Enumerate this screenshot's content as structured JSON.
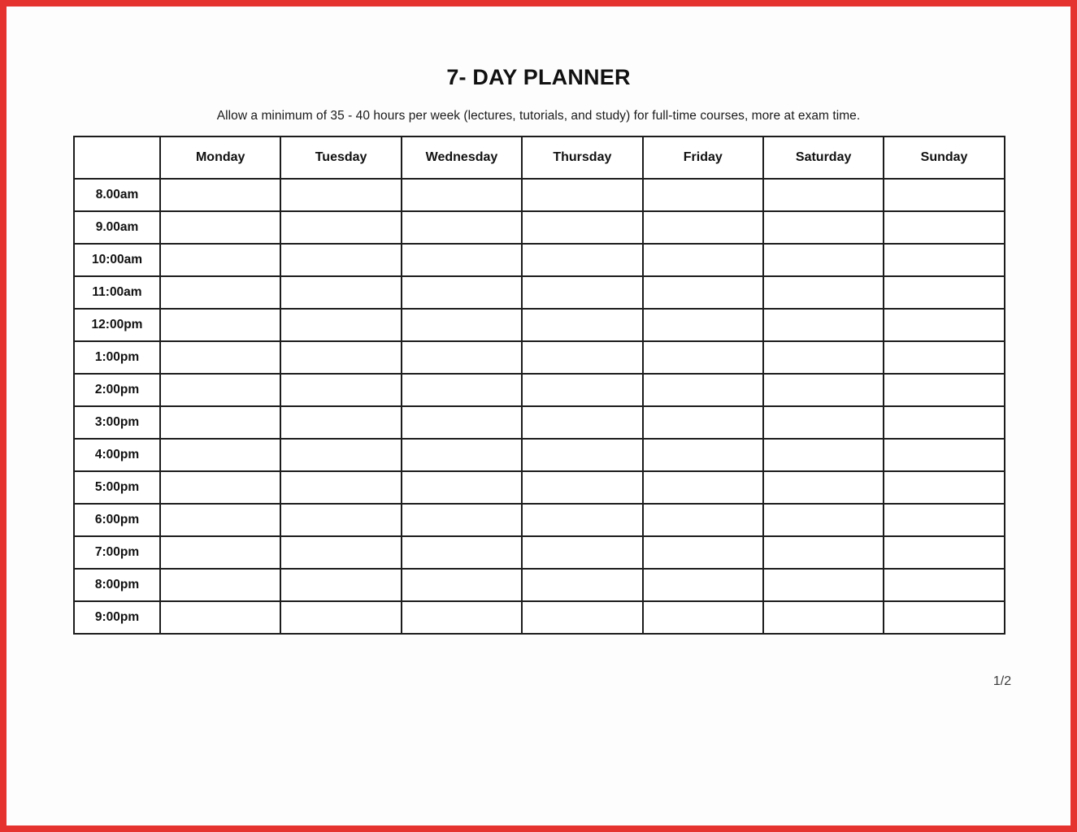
{
  "document": {
    "title": "7- DAY PLANNER",
    "subtitle": "Allow a minimum of 35 - 40 hours per week (lectures, tutorials, and study) for full-time courses, more at exam time.",
    "page_number": "1/2",
    "frame_color": "#e5332f",
    "page_background": "#fdfdfd",
    "grid_color": "#1c1c1c"
  },
  "planner": {
    "corner_header": "",
    "day_headers": [
      "Monday",
      "Tuesday",
      "Wednesday",
      "Thursday",
      "Friday",
      "Saturday",
      "Sunday"
    ],
    "time_labels": [
      "8.00am",
      "9.00am",
      "10:00am",
      "11:00am",
      "12:00pm",
      "1:00pm",
      "2:00pm",
      "3:00pm",
      "4:00pm",
      "5:00pm",
      "6:00pm",
      "7:00pm",
      "8:00pm",
      "9:00pm"
    ],
    "entries": [
      [
        "",
        "",
        "",
        "",
        "",
        "",
        ""
      ],
      [
        "",
        "",
        "",
        "",
        "",
        "",
        ""
      ],
      [
        "",
        "",
        "",
        "",
        "",
        "",
        ""
      ],
      [
        "",
        "",
        "",
        "",
        "",
        "",
        ""
      ],
      [
        "",
        "",
        "",
        "",
        "",
        "",
        ""
      ],
      [
        "",
        "",
        "",
        "",
        "",
        "",
        ""
      ],
      [
        "",
        "",
        "",
        "",
        "",
        "",
        ""
      ],
      [
        "",
        "",
        "",
        "",
        "",
        "",
        ""
      ],
      [
        "",
        "",
        "",
        "",
        "",
        "",
        ""
      ],
      [
        "",
        "",
        "",
        "",
        "",
        "",
        ""
      ],
      [
        "",
        "",
        "",
        "",
        "",
        "",
        ""
      ],
      [
        "",
        "",
        "",
        "",
        "",
        "",
        ""
      ],
      [
        "",
        "",
        "",
        "",
        "",
        "",
        ""
      ],
      [
        "",
        "",
        "",
        "",
        "",
        "",
        ""
      ]
    ]
  }
}
